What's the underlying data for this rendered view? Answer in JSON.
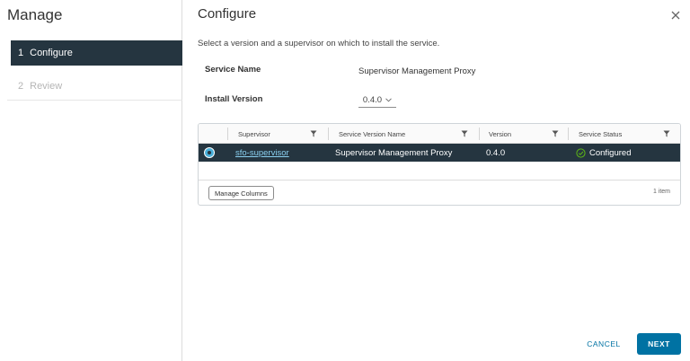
{
  "sidebar": {
    "title": "Manage",
    "steps": [
      {
        "number": "1",
        "label": "Configure",
        "state": "active"
      },
      {
        "number": "2",
        "label": "Review",
        "state": "disabled"
      }
    ]
  },
  "dialog": {
    "title": "Configure",
    "subtitle": "Select a version and a supervisor on which to install the service.",
    "service_name_label": "Service Name",
    "service_name_value": "Supervisor Management Proxy",
    "install_version_label": "Install Version",
    "install_version_value": "0.4.0"
  },
  "grid": {
    "columns": [
      "Supervisor",
      "Service Version Name",
      "Version",
      "Service Status"
    ],
    "rows": [
      {
        "supervisor": "sfo-supervisor",
        "service_version_name": "Supervisor Management Proxy",
        "version": "0.4.0",
        "status": "Configured",
        "selected": true
      }
    ],
    "manage_columns_label": "Manage Columns",
    "item_count": "1 item"
  },
  "actions": {
    "cancel_label": "CANCEL",
    "next_label": "NEXT"
  },
  "colors": {
    "accent": "#0072a3",
    "selected_row": "#253540",
    "status_ok": "#5eb715"
  }
}
